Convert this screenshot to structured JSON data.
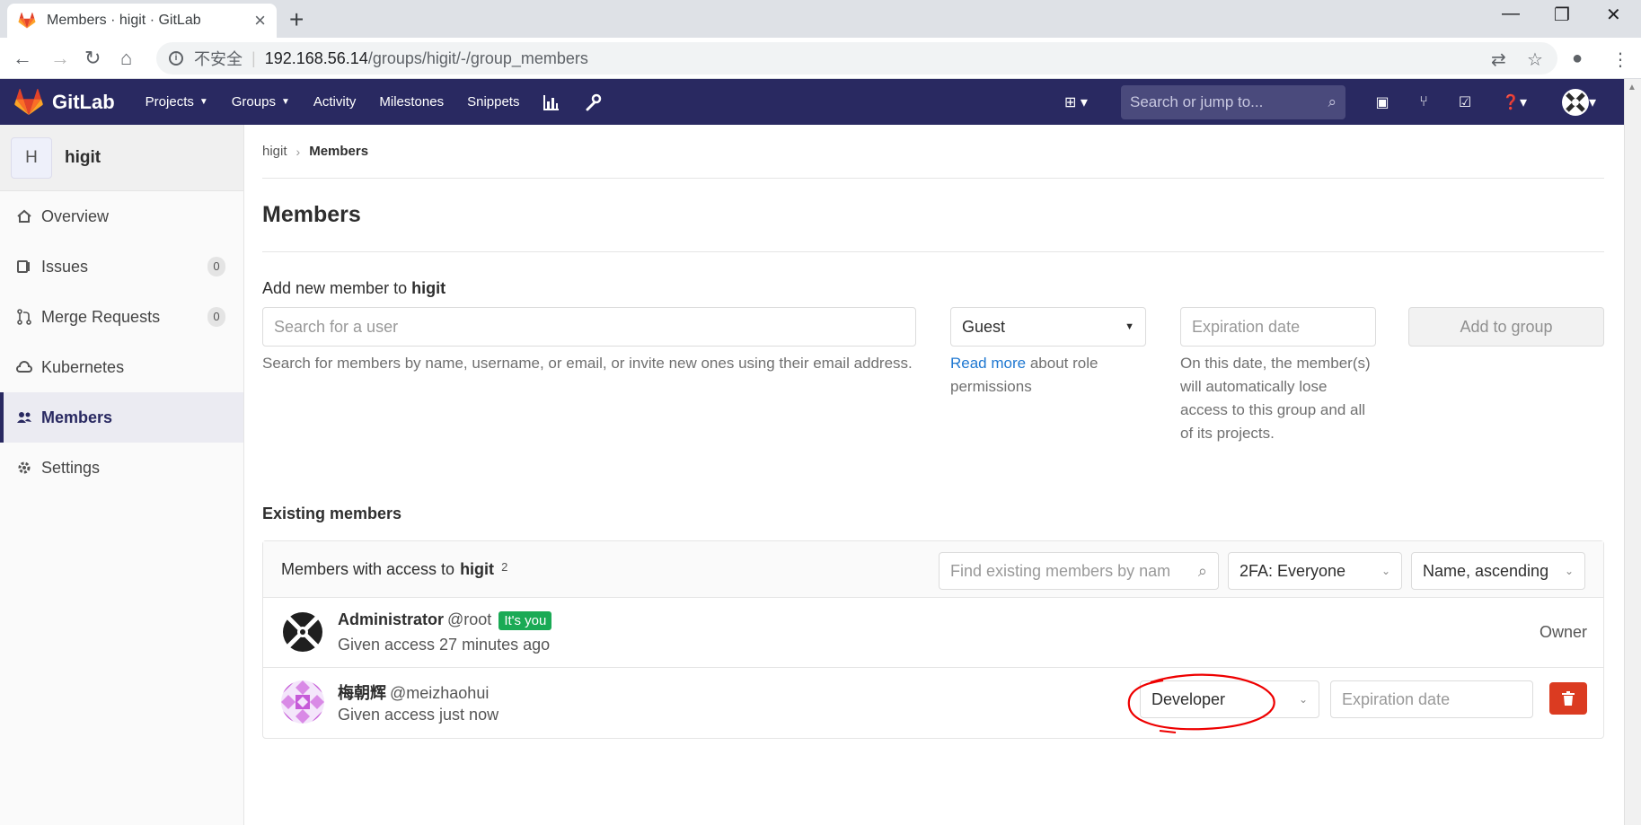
{
  "browser": {
    "tab_title": "Members · higit · GitLab",
    "omnibox_insecure": "不安全",
    "omnibox_host": "192.168.56.14",
    "omnibox_path": "/groups/higit/-/group_members"
  },
  "header": {
    "logo_text": "GitLab",
    "nav": [
      "Projects",
      "Groups",
      "Activity",
      "Milestones",
      "Snippets"
    ],
    "search_placeholder": "Search or jump to..."
  },
  "sidebar": {
    "group_initial": "H",
    "group_name": "higit",
    "items": [
      {
        "label": "Overview"
      },
      {
        "label": "Issues",
        "count": "0"
      },
      {
        "label": "Merge Requests",
        "count": "0"
      },
      {
        "label": "Kubernetes"
      },
      {
        "label": "Members"
      },
      {
        "label": "Settings"
      }
    ]
  },
  "breadcrumb": {
    "group": "higit",
    "current": "Members"
  },
  "page_title": "Members",
  "add_member": {
    "label_prefix": "Add new member to",
    "group": "higit",
    "search_placeholder": "Search for a user",
    "search_help": "Search for members by name, username, or email, or invite new ones using their email address.",
    "role_value": "Guest",
    "read_more": "Read more",
    "role_help": "about role permissions",
    "expiration_placeholder": "Expiration date",
    "expiration_help": "On this date, the member(s) will automatically lose access to this group and all of its projects.",
    "add_button": "Add to group"
  },
  "existing": {
    "label": "Existing members",
    "panel_prefix": "Members with access to",
    "group": "higit",
    "count": "2",
    "filter_placeholder": "Find existing members by nam",
    "twofa": "2FA: Everyone",
    "sort": "Name, ascending",
    "members": [
      {
        "name": "Administrator",
        "username": "@root",
        "badge": "It's you",
        "access": "Given access 27 minutes ago",
        "role": "Owner"
      },
      {
        "name": "梅朝辉",
        "username": "@meizhaohui",
        "access": "Given access just now",
        "role": "Developer",
        "expiration_placeholder": "Expiration date"
      }
    ]
  },
  "colors": {
    "header": "#292961",
    "danger": "#db3b21",
    "success": "#1aaa55",
    "link": "#1f78d1"
  }
}
